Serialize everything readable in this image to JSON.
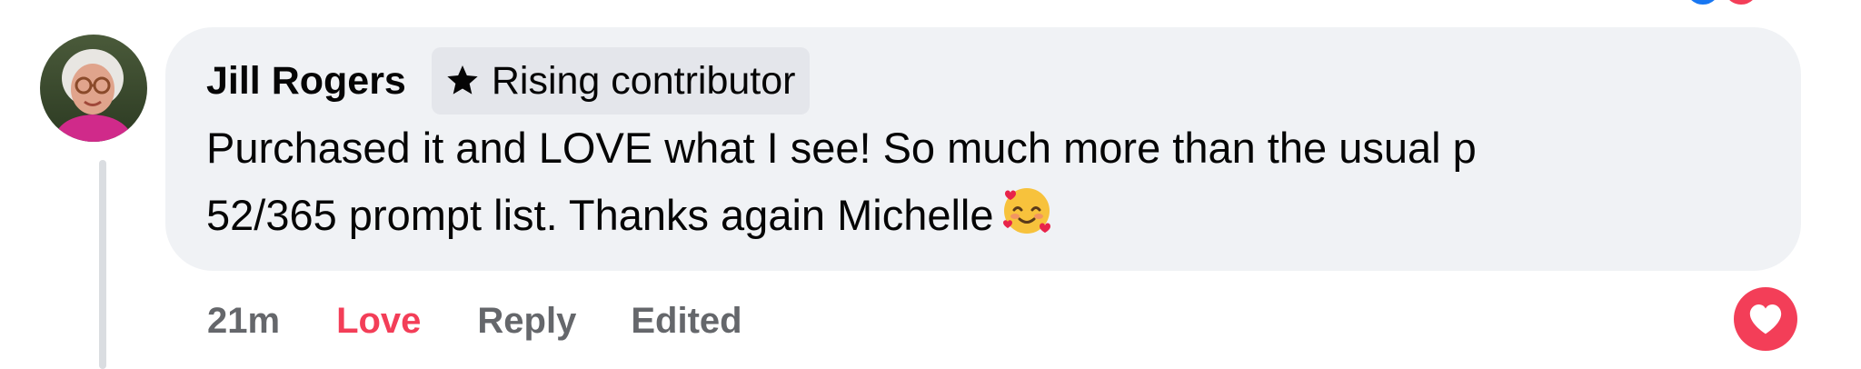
{
  "comment": {
    "author": "Jill Rogers",
    "badge": {
      "icon": "star-icon",
      "label": "Rising contributor"
    },
    "text_lines": [
      "Purchased it and LOVE what I see! So much more than the usual p",
      "52/365 prompt list. Thanks again Michelle"
    ],
    "emoji": "smiling-face-with-hearts"
  },
  "actions": {
    "timestamp": "21m",
    "love_label": "Love",
    "reply_label": "Reply",
    "edited_label": "Edited"
  },
  "reaction": {
    "icon": "heart-icon",
    "color": "#f33e58"
  },
  "colors": {
    "bubble_bg": "#f0f2f5",
    "love_active": "#f33e58",
    "secondary_text": "#65676b"
  }
}
